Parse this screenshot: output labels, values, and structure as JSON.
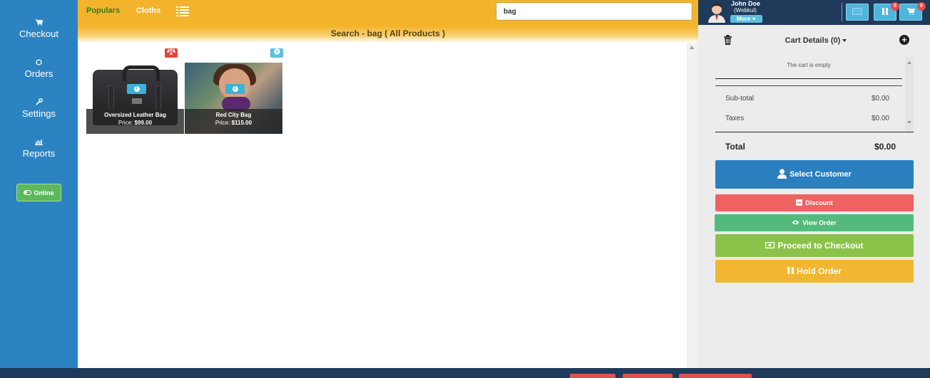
{
  "sidebar": {
    "items": [
      {
        "label": "Checkout",
        "icon": "cart-icon"
      },
      {
        "label": "Orders",
        "icon": "circle-icon"
      },
      {
        "label": "Settings",
        "icon": "wrench-icon"
      },
      {
        "label": "Reports",
        "icon": "bar-chart-icon"
      }
    ],
    "status_label": "Online"
  },
  "topbar": {
    "tabs": [
      {
        "label": "Populars",
        "active": true
      },
      {
        "label": "Cloths",
        "active": false
      }
    ],
    "search_value": "bag",
    "search_title": "Search - bag ( All Products )"
  },
  "products": [
    {
      "name": "Oversized Leather Bag",
      "price_label": "Price:",
      "price": "$99.00",
      "badge": "compare-icon"
    },
    {
      "name": "Red City Bag",
      "price_label": "Price:",
      "price": "$115.00",
      "badge": "question-icon"
    }
  ],
  "user": {
    "name": "John Doe",
    "company": "(Webkul)",
    "more_label": "More"
  },
  "top_buttons": {
    "hold_count": "0",
    "cart_count": "0"
  },
  "cart": {
    "title": "Cart Details (0)",
    "empty_text": "The cart is empty",
    "subtotal_label": "Sub-total",
    "subtotal_value": "$0.00",
    "taxes_label": "Taxes",
    "taxes_value": "$0.00",
    "total_label": "Total",
    "total_value": "$0.00"
  },
  "actions": {
    "select_customer": "Select Customer",
    "discount": "Discount",
    "view_order": "View Order",
    "proceed_checkout": "Proceed to Checkout",
    "hold_order": "Hold Order"
  },
  "colors": {
    "sidebar": "#2c83c2",
    "topbar": "#f3b42c",
    "header": "#1f3a5a",
    "discount": "#f06262",
    "view_order": "#52bb7b",
    "checkout": "#8bc34a",
    "hold": "#f2b632"
  }
}
